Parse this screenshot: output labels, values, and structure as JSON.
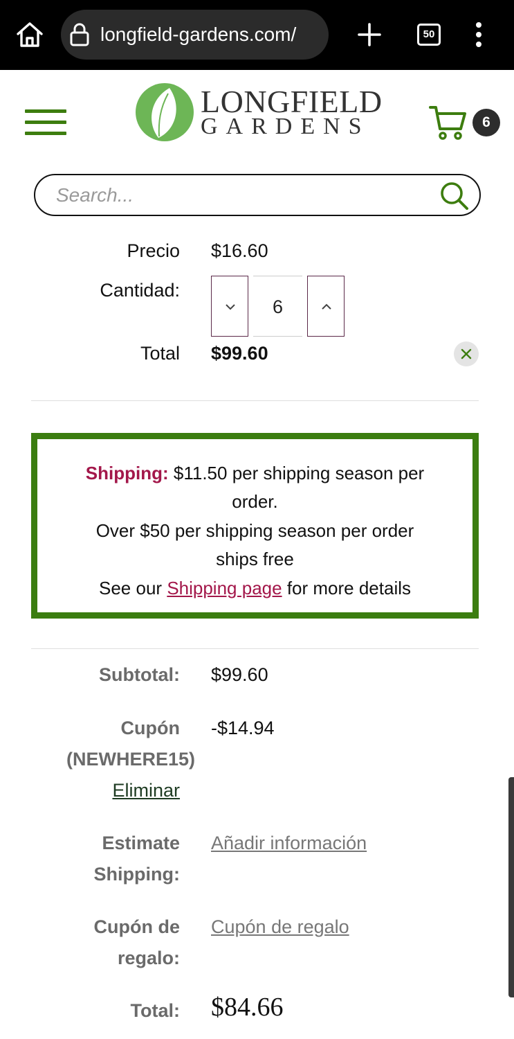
{
  "browser": {
    "url": "longfield-gardens.com/",
    "tab_count": "50"
  },
  "header": {
    "logo_line1": "LONGFIELD",
    "logo_line2": "GARDENS",
    "cart_count": "6"
  },
  "search": {
    "placeholder": "Search..."
  },
  "item": {
    "price_label": "Precio",
    "price_value": "$16.60",
    "quantity_label": "Cantidad:",
    "quantity_value": "6",
    "total_label": "Total",
    "total_value": "$99.60"
  },
  "shipping": {
    "label": "Shipping:",
    "line1_rest": "$11.50  per shipping season per",
    "line2": "order.",
    "line3": "Over $50 per shipping season per order",
    "line4": "ships free",
    "line5_before": "See our",
    "line5_link": "Shipping page",
    "line5_after": "for more details"
  },
  "totals": {
    "subtotal_label": "Subtotal:",
    "subtotal_value": "$99.60",
    "coupon_label": "Cupón",
    "coupon_code": "(NEWHERE15)",
    "coupon_remove": "Eliminar",
    "coupon_value": "-$14.94",
    "estimate_label_1": "Estimate",
    "estimate_label_2": "Shipping:",
    "estimate_link": "Añadir información",
    "gift_label_1": "Cupón de",
    "gift_label_2": "regalo:",
    "gift_link": "Cupón de regalo",
    "total_label": "Total:",
    "total_value": "$84.66"
  },
  "colors": {
    "brand_green": "#3b7d10",
    "accent_magenta": "#a3174a"
  }
}
